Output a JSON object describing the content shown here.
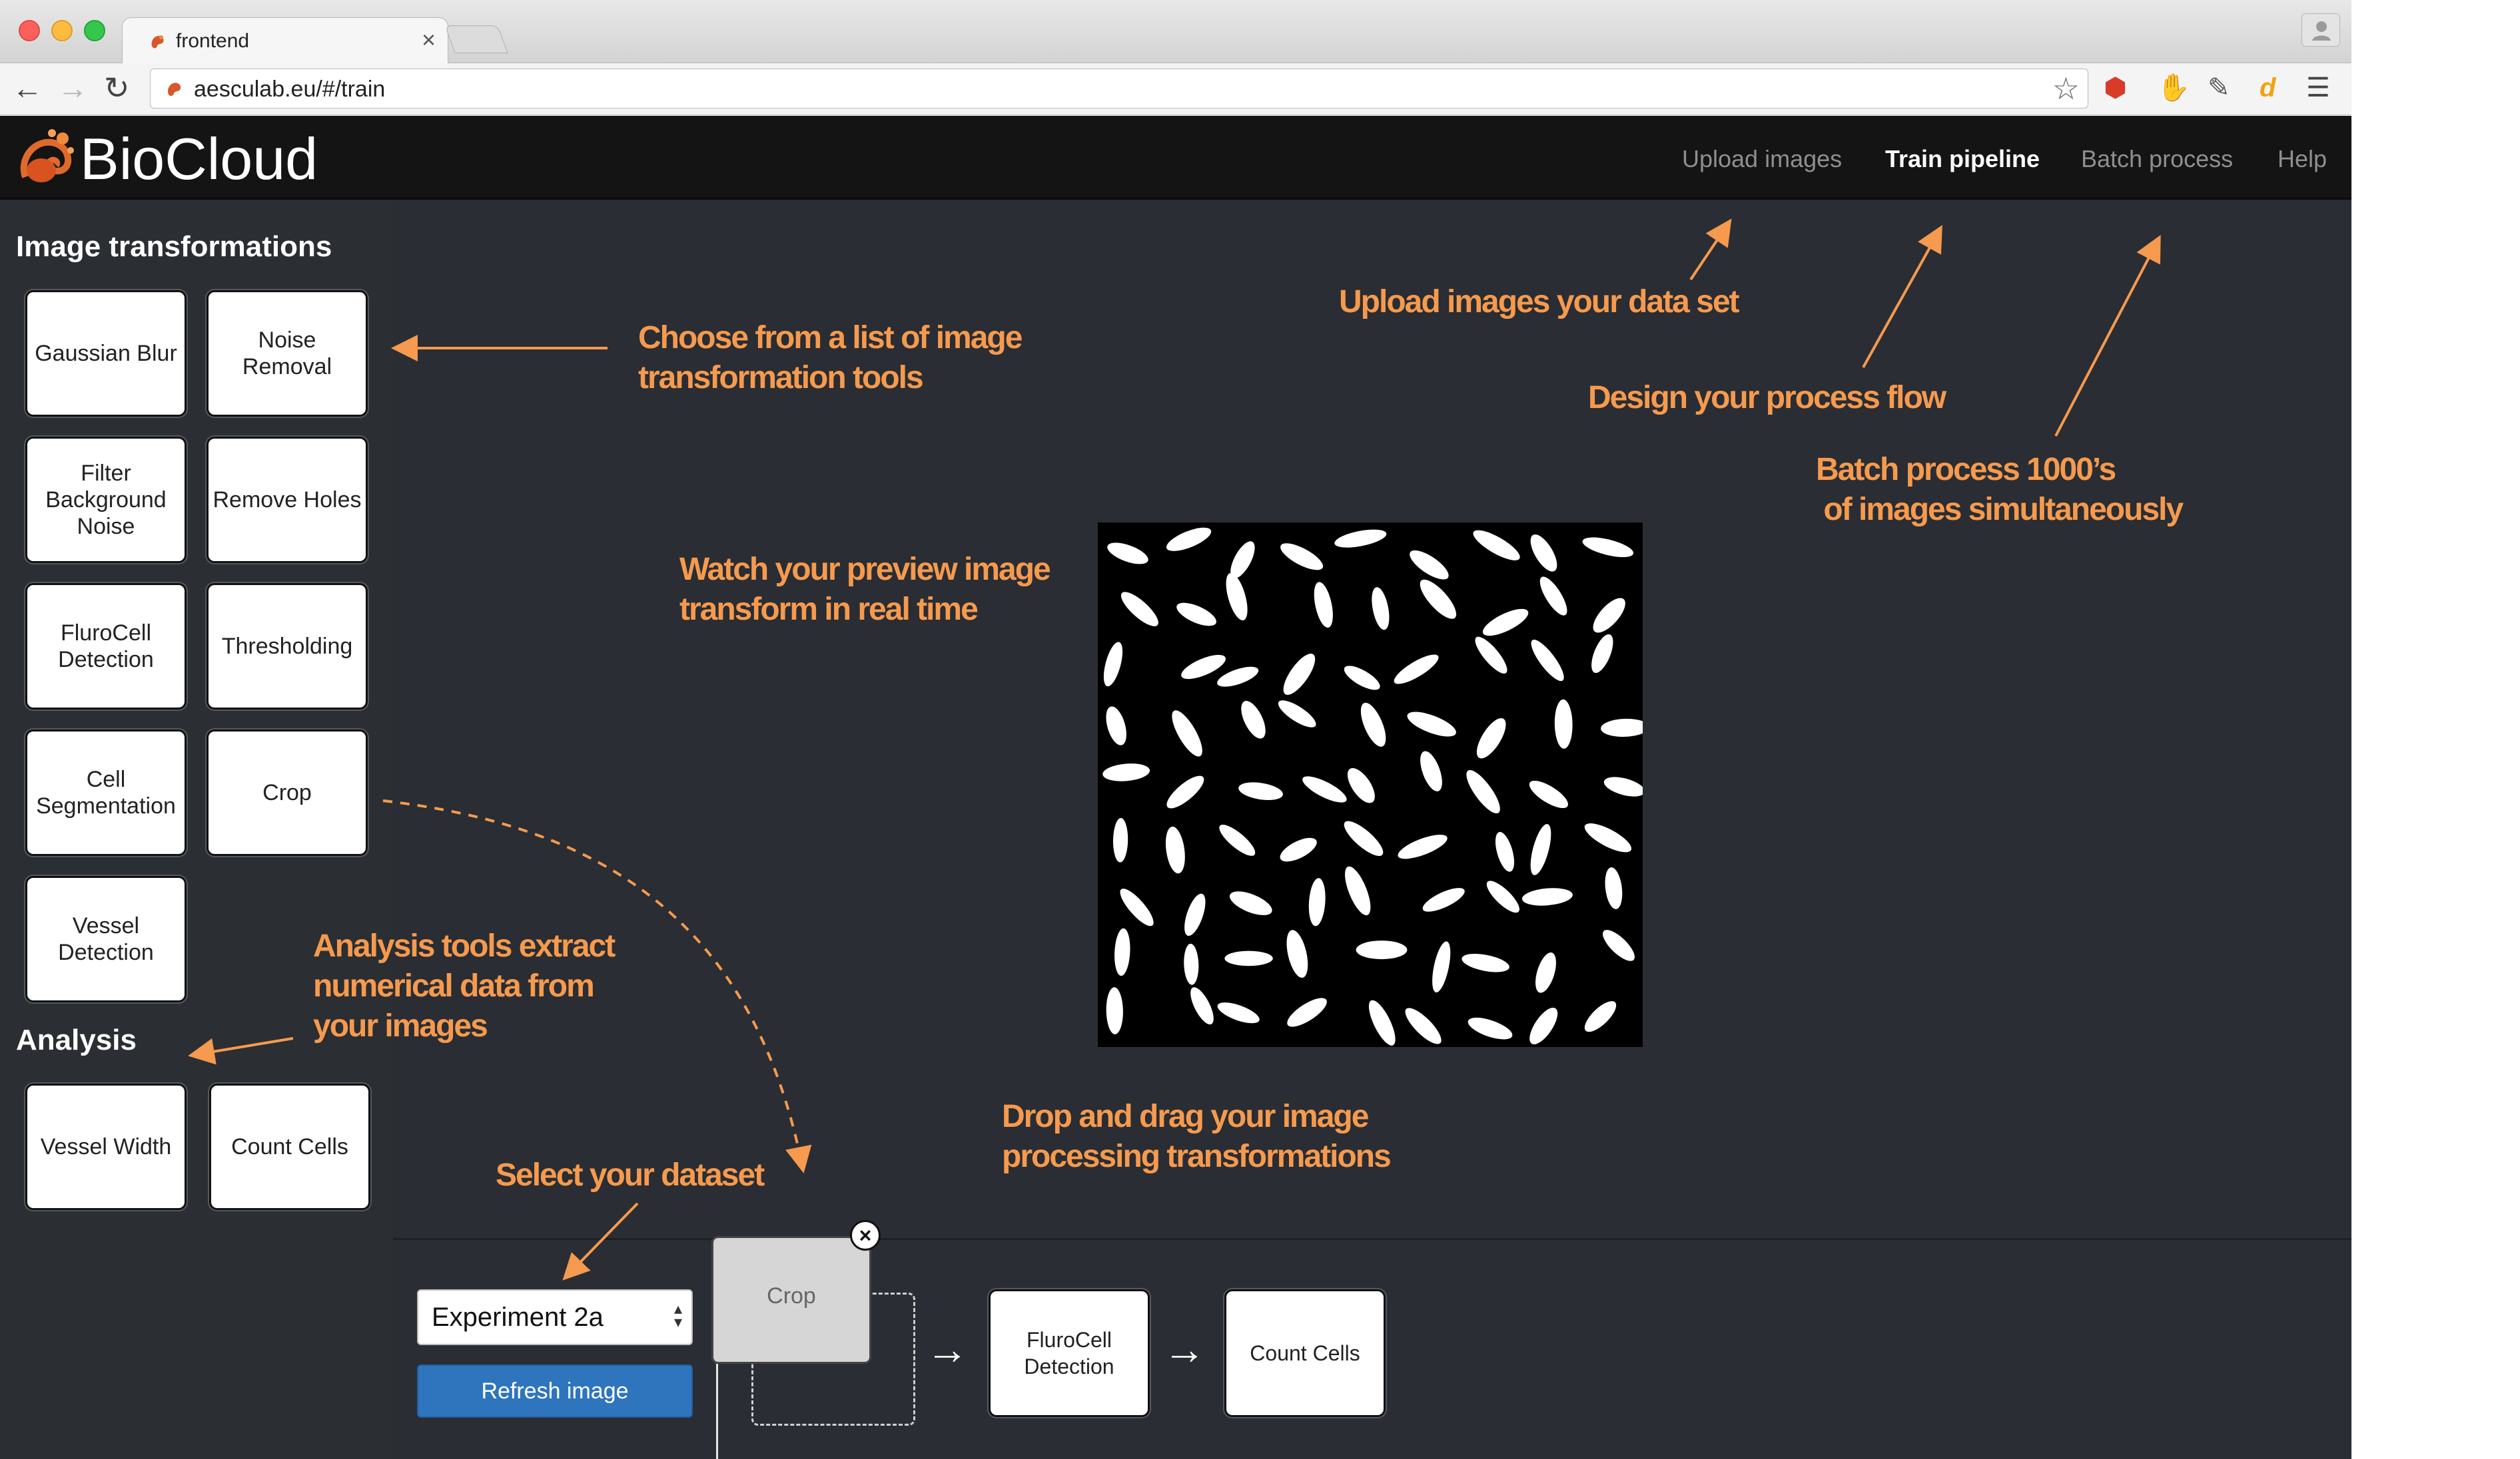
{
  "browser": {
    "tab_title": "frontend",
    "tab_close": "×",
    "url": "aesculab.eu/#/train",
    "back": "←",
    "forward": "→",
    "reload": "↻",
    "star": "☆"
  },
  "app": {
    "logo_text": "BioCloud",
    "nav": [
      {
        "label": "Upload images",
        "active": false
      },
      {
        "label": "Train pipeline",
        "active": true
      },
      {
        "label": "Batch process",
        "active": false
      },
      {
        "label": "Help",
        "active": false
      }
    ]
  },
  "sidebar": {
    "image_transformations_title": "Image transformations",
    "image_transformations": [
      "Gaussian Blur",
      "Noise Removal",
      "Filter Background Noise",
      "Remove Holes",
      "FluroCell Detection",
      "Thresholding",
      "Cell Segmentation",
      "Crop",
      "Vessel Detection"
    ],
    "analysis_title": "Analysis",
    "analysis_tools": [
      "Vessel Width",
      "Count Cells"
    ]
  },
  "controls": {
    "dataset_selected": "Experiment 2a",
    "select_arrows": "▲▼",
    "refresh_label": "Refresh image"
  },
  "pipeline": {
    "dragging_label": "Crop",
    "remove_label": "×",
    "arrow": "→",
    "nodes": [
      "FluroCell Detection",
      "Count Cells"
    ]
  },
  "annotations": {
    "choose_tools": [
      "Choose from a list of image",
      "transformation tools"
    ],
    "upload": [
      "Upload images your data set"
    ],
    "design": [
      "Design your process flow"
    ],
    "batch": [
      "Batch process 1000’s",
      " of images simultaneously"
    ],
    "watch": [
      "Watch your preview image",
      "transform in real time"
    ],
    "analysis": [
      "Analysis tools extract",
      "numerical data from",
      "your images"
    ],
    "drop": [
      "Drop and drag your image",
      "processing transformations"
    ],
    "select": [
      "Select your dataset"
    ]
  },
  "colors": {
    "annotation": "#f59a4e",
    "navbar_bg": "#141414",
    "panel_bg": "#2a2d33",
    "button_blue": "#2e75bd"
  }
}
